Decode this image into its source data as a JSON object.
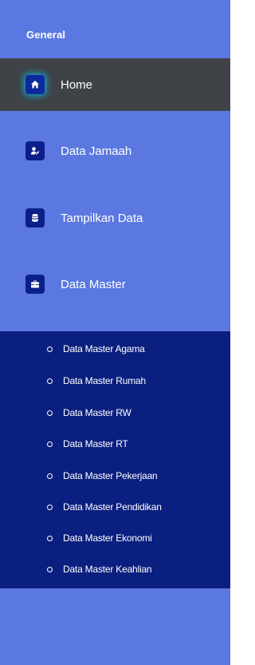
{
  "sidebar": {
    "section_title": "General",
    "colors": {
      "background": "#5a78e0",
      "active_background": "#3f4348",
      "submenu_background": "#0b1f80",
      "icon_background": "#0b1f8a",
      "active_glow": "#00c8ff",
      "text": "#ffffff"
    },
    "items": [
      {
        "label": "Home",
        "icon": "home-icon",
        "active": true
      },
      {
        "label": "Data Jamaah",
        "icon": "user-edit-icon",
        "active": false
      },
      {
        "label": "Tampilkan Data",
        "icon": "database-icon",
        "active": false
      },
      {
        "label": "Data Master",
        "icon": "briefcase-icon",
        "active": false,
        "expanded": true
      }
    ],
    "submenu": [
      {
        "label": "Data Master Agama",
        "icon": "circle-bullet-icon"
      },
      {
        "label": "Data Master Rumah",
        "icon": "circle-bullet-icon"
      },
      {
        "label": "Data Master RW",
        "icon": "circle-bullet-icon"
      },
      {
        "label": "Data Master RT",
        "icon": "circle-bullet-icon"
      },
      {
        "label": "Data Master Pekerjaan",
        "icon": "circle-bullet-icon"
      },
      {
        "label": "Data Master Pendidikan",
        "icon": "circle-bullet-icon"
      },
      {
        "label": "Data Master Ekonomi",
        "icon": "circle-bullet-icon"
      },
      {
        "label": "Data Master Keahlian",
        "icon": "circle-bullet-icon"
      }
    ]
  }
}
